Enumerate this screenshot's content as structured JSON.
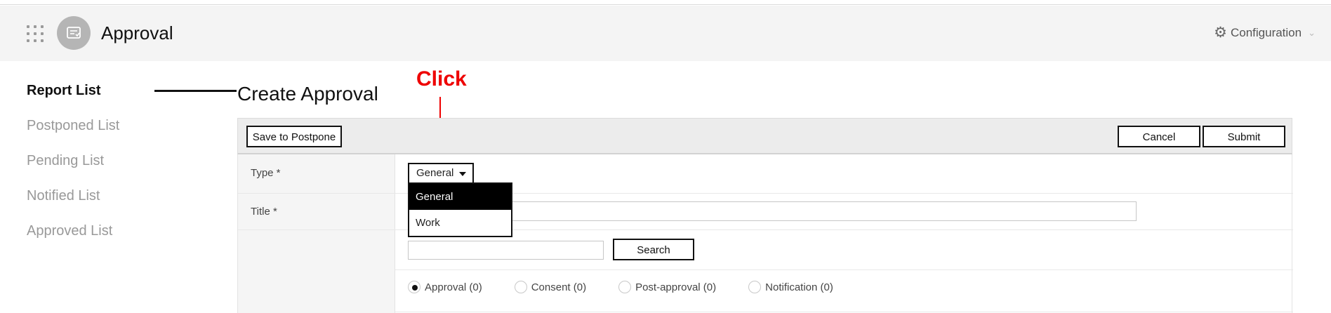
{
  "header": {
    "app_title": "Approval",
    "config_label": "Configuration"
  },
  "sidebar": {
    "items": [
      {
        "label": "Report List",
        "active": true
      },
      {
        "label": "Postponed List"
      },
      {
        "label": "Pending List"
      },
      {
        "label": "Notified List"
      },
      {
        "label": "Approved List"
      }
    ]
  },
  "main": {
    "page_title": "Create Approval",
    "annotation": "Click",
    "toolbar": {
      "save_label": "Save to Postpone",
      "cancel_label": "Cancel",
      "submit_label": "Submit"
    },
    "form": {
      "type_label": "Type *",
      "type_value": "General",
      "type_options": [
        "General",
        "Work"
      ],
      "title_label": "Title *",
      "title_value": "",
      "search_value": "",
      "search_button": "Search",
      "radios": [
        {
          "label": "Approval (0)",
          "checked": true
        },
        {
          "label": "Consent (0)"
        },
        {
          "label": "Post-approval (0)"
        },
        {
          "label": "Notification (0)"
        }
      ]
    }
  },
  "colors": {
    "header_bg": "#f4f4f4",
    "annotation": "#ee0000",
    "selected_option_bg": "#000000"
  }
}
